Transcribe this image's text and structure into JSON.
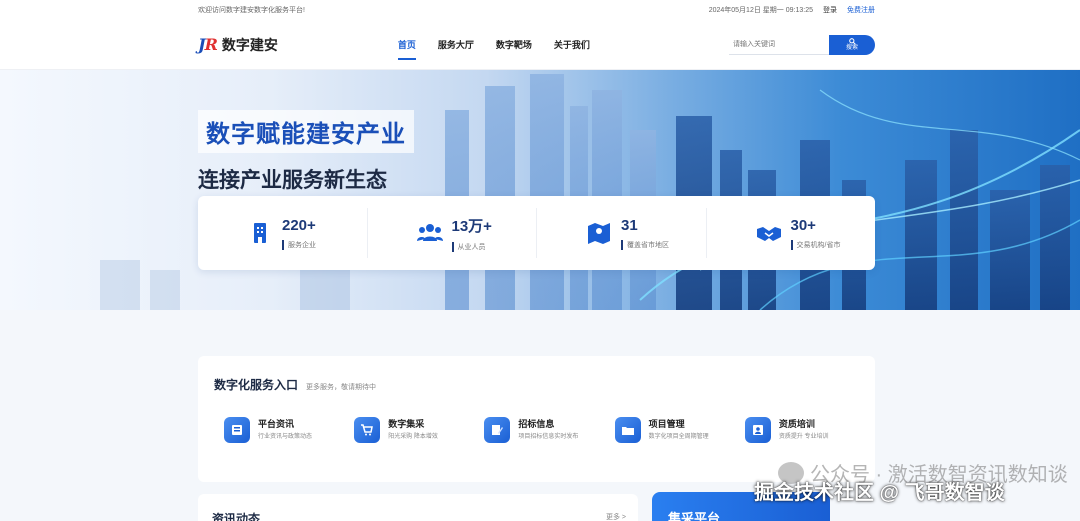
{
  "topbar": {
    "welcome": "欢迎访问数字建安数字化服务平台!",
    "datetime": "2024年05月12日 星期一 09:13:25",
    "login": "登录",
    "register": "免费注册"
  },
  "header": {
    "logo_mark_a": "J",
    "logo_mark_b": "R",
    "logo_name": "数字建安",
    "nav": [
      "首页",
      "服务大厅",
      "数字靶场",
      "关于我们"
    ],
    "search_placeholder": "请输入关键词",
    "search_button": "搜索"
  },
  "hero": {
    "slogan1": "数字赋能建安产业",
    "slogan2": "连接产业服务新生态",
    "stats": [
      {
        "icon": "building-icon",
        "value": "220+",
        "label": "服务企业"
      },
      {
        "icon": "users-icon",
        "value": "13万+",
        "label": "从业人员"
      },
      {
        "icon": "map-icon",
        "value": "31",
        "label": "覆盖省市地区"
      },
      {
        "icon": "handshake-icon",
        "value": "30+",
        "label": "交易机构/省市"
      }
    ]
  },
  "services": {
    "title": "数字化服务入口",
    "subtitle": "更多服务，敬请期待中",
    "items": [
      {
        "icon": "news-icon",
        "title": "平台资讯",
        "desc": "行业资讯与政策动态"
      },
      {
        "icon": "cart-icon",
        "title": "数字集采",
        "desc": "阳光采购 降本增效"
      },
      {
        "icon": "edit-icon",
        "title": "招标信息",
        "desc": "项目招标信息实时发布"
      },
      {
        "icon": "folder-icon",
        "title": "项目管理",
        "desc": "数字化项目全周期管理"
      },
      {
        "icon": "training-icon",
        "title": "资质培训",
        "desc": "资质提升 专业培训"
      }
    ]
  },
  "news": {
    "title": "资讯动态",
    "more": "更多 >"
  },
  "platform": {
    "title": "集采平台"
  },
  "watermark": {
    "line1": "公众号 · 激活数智资讯数知谈",
    "line2": "掘金技术社区 @ 飞哥数智谈"
  },
  "colors": {
    "primary": "#1a5fd4",
    "navy": "#1d3a78",
    "hero_blue": "#1f6fc4"
  }
}
